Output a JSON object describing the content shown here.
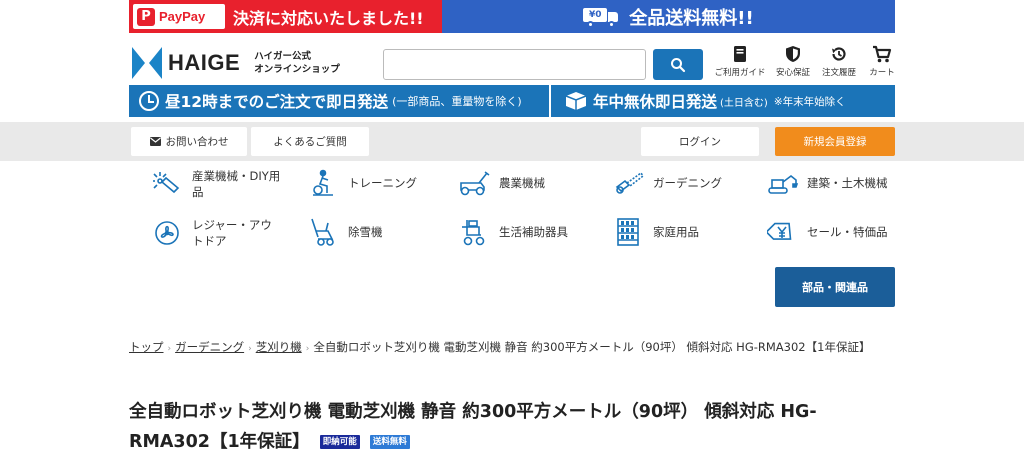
{
  "promo": {
    "paypay_label": "PayPay",
    "paypay_message": "決済に対応いたしました!!",
    "truck_label": "¥0",
    "free_shipping": "全品送料無料!!"
  },
  "header": {
    "logo_text": "HAIGE",
    "logo_sub_1": "ハイガー公式",
    "logo_sub_2": "オンラインショップ",
    "search_placeholder": "",
    "icons": [
      {
        "label": "ご利用ガイド",
        "icon": "book-icon"
      },
      {
        "label": "安心保証",
        "icon": "shield-icon"
      },
      {
        "label": "注文履歴",
        "icon": "history-icon"
      },
      {
        "label": "カート",
        "icon": "cart-icon"
      }
    ]
  },
  "shipping": {
    "left_main": "昼12時までのご注文で即日発送",
    "left_sub": "(一部商品、重量物を除く)",
    "right_main": "年中無休即日発送",
    "right_sub": "(土日含む)",
    "right_note": "※年末年始除く"
  },
  "nav": {
    "contact": "お問い合わせ",
    "faq": "よくあるご質問",
    "login": "ログイン",
    "register": "新規会員登録"
  },
  "categories": [
    {
      "label": "産業機械・DIY用品",
      "icon": "spark-tool-icon"
    },
    {
      "label": "トレーニング",
      "icon": "exercise-bike-icon"
    },
    {
      "label": "農業機械",
      "icon": "lawn-mower-icon"
    },
    {
      "label": "ガーデニング",
      "icon": "chainsaw-icon"
    },
    {
      "label": "建築・土木機械",
      "icon": "excavator-icon"
    },
    {
      "label": "レジャー・アウトドア",
      "icon": "fan-icon"
    },
    {
      "label": "除雪機",
      "icon": "snowblower-icon"
    },
    {
      "label": "生活補助器具",
      "icon": "wheelchair-icon"
    },
    {
      "label": "家庭用品",
      "icon": "shelf-icon"
    },
    {
      "label": "セール・特価品",
      "icon": "yen-tag-icon"
    }
  ],
  "parts_button": "部品・関連品",
  "breadcrumb": {
    "home": "トップ",
    "level1": "ガーデニング",
    "level2": "芝刈り機",
    "current": "全自動ロボット芝刈り機 電動芝刈機 静音 約300平方メートル（90坪） 傾斜対応 HG-RMA302【1年保証】"
  },
  "product": {
    "title": "全自動ロボット芝刈り機 電動芝刈機 静音 約300平方メートル（90坪） 傾斜対応 HG-RMA302【1年保証】",
    "tag_1": "即納可能",
    "tag_2": "送料無料"
  },
  "colors": {
    "brand_blue": "#1b74b8",
    "paypay_red": "#e8212d",
    "promo_blue": "#2f62c4",
    "register_orange": "#f18c1c",
    "parts_navy": "#1b5e99"
  }
}
